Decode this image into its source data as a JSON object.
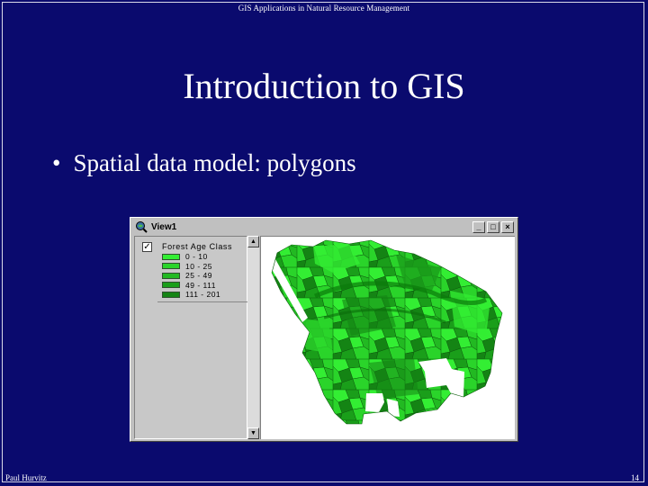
{
  "slide": {
    "header": "GIS Applications in Natural Resource Management",
    "title": "Introduction to GIS",
    "bullet_text": "Spatial data model: polygons",
    "bullet_glyph": "•",
    "footer_author": "Paul Hurvitz",
    "page_number": "14",
    "background_color": "#0a0a6e"
  },
  "window": {
    "title": "View1",
    "controls": [
      "_",
      "□",
      "×"
    ],
    "icon": "magnifier-globe-icon"
  },
  "legend": {
    "checked_mark": "✓",
    "theme_title": "Forest Age Class",
    "classes": [
      {
        "label": "0 - 10",
        "color": "#33ee33"
      },
      {
        "label": "10 - 25",
        "color": "#2ad42a"
      },
      {
        "label": "25 - 49",
        "color": "#22b922"
      },
      {
        "label": "49 - 111",
        "color": "#1a9e1a"
      },
      {
        "label": "111 - 201",
        "color": "#148414"
      }
    ]
  },
  "scrollbar": {
    "up_arrow": "▲",
    "down_arrow": "▼"
  }
}
